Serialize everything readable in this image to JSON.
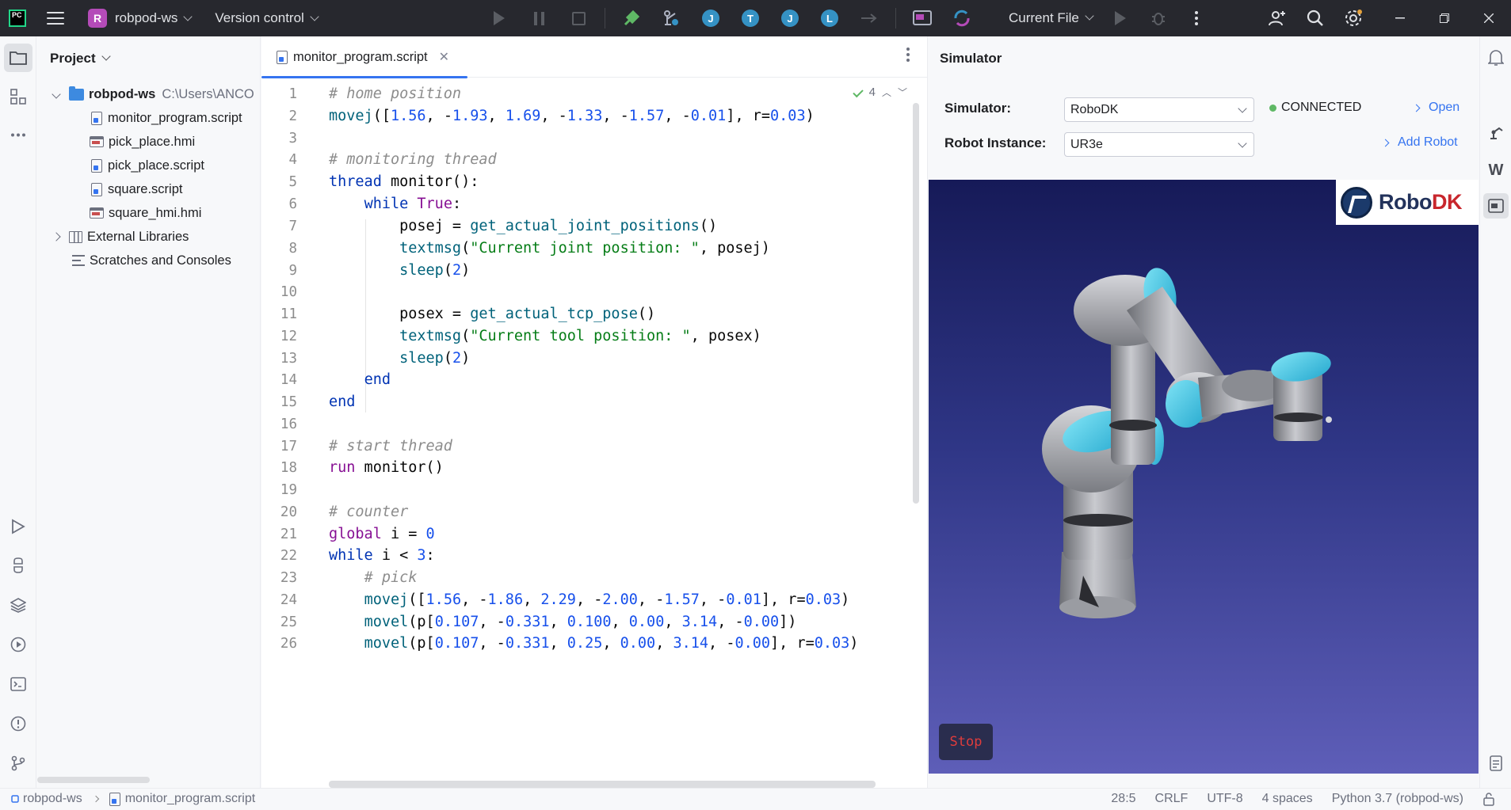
{
  "titlebar": {
    "project_badge": "R",
    "project_name": "robpod-ws",
    "vcs_label": "Version control",
    "run_config": "Current File",
    "tool_circles": [
      "J",
      "T",
      "J",
      "L"
    ]
  },
  "project_panel": {
    "title": "Project",
    "root": {
      "name": "robpod-ws",
      "path": "C:\\Users\\ANCO"
    },
    "files": [
      {
        "name": "monitor_program.script",
        "kind": "script"
      },
      {
        "name": "pick_place.hmi",
        "kind": "hmi"
      },
      {
        "name": "pick_place.script",
        "kind": "script"
      },
      {
        "name": "square.script",
        "kind": "script"
      },
      {
        "name": "square_hmi.hmi",
        "kind": "hmi"
      }
    ],
    "external_libraries": "External Libraries",
    "scratches": "Scratches and Consoles"
  },
  "editor": {
    "tab_name": "monitor_program.script",
    "warning_count": "4",
    "line_numbers": [
      "1",
      "2",
      "3",
      "4",
      "5",
      "6",
      "7",
      "8",
      "9",
      "10",
      "11",
      "12",
      "13",
      "14",
      "15",
      "16",
      "17",
      "18",
      "19",
      "20",
      "21",
      "22",
      "23",
      "24",
      "25",
      "26"
    ]
  },
  "simulator": {
    "title": "Simulator",
    "simulator_label": "Simulator:",
    "simulator_value": "RoboDK",
    "status": "CONNECTED",
    "status_color": "#5fb865",
    "open_link": "Open",
    "robot_label": "Robot Instance:",
    "robot_value": "UR3e",
    "add_robot_link": "Add Robot",
    "logo_text_a": "Robo",
    "logo_text_b": "DK",
    "stop_label": "Stop"
  },
  "statusbar": {
    "breadcrumb_project": "robpod-ws",
    "breadcrumb_file": "monitor_program.script",
    "cursor": "28:5",
    "line_sep": "CRLF",
    "encoding": "UTF-8",
    "indent": "4 spaces",
    "interpreter": "Python 3.7 (robpod-ws)"
  },
  "colors": {
    "accent": "#3574f0",
    "titlebar_bg": "#27282e",
    "viewport_top": "#161a58",
    "viewport_bottom": "#5e5eb8",
    "robot_accent": "#3cc8e6"
  }
}
